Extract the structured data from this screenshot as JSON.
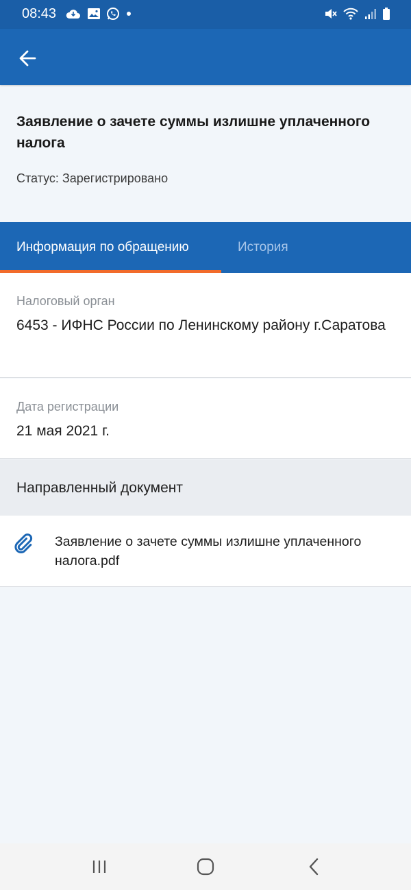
{
  "status_bar": {
    "time": "08:43",
    "left_icons": [
      "cloud-icon",
      "image-icon",
      "whatsapp-icon",
      "dot-icon"
    ],
    "right_icons": [
      "mute-icon",
      "wifi-icon",
      "signal-icon",
      "battery-icon"
    ]
  },
  "app_bar": {
    "back_icon": "arrow-back-icon",
    "color": "#1c67b5"
  },
  "header": {
    "title": "Заявление о зачете суммы излишне уплаченного налога",
    "status": "Статус: Зарегистрировано"
  },
  "tabs": [
    {
      "label": "Информация по обращению",
      "active": true
    },
    {
      "label": "История",
      "active": false
    }
  ],
  "fields": {
    "tax_authority": {
      "label": "Налоговый орган",
      "value": "6453 - ИФНС России по Ленинскому району г.Саратова"
    },
    "registration_date": {
      "label": "Дата регистрации",
      "value": "21 мая 2021 г."
    }
  },
  "sent_document": {
    "section_title": "Направленный документ",
    "file_name": "Заявление о зачете суммы излишне уплаченного налога.pdf",
    "icon": "paperclip-icon"
  },
  "colors": {
    "primary": "#1c67b5",
    "accent": "#f26b2a",
    "background": "#f2f6fa"
  },
  "nav": [
    "recent-apps-icon",
    "home-icon",
    "back-icon"
  ]
}
